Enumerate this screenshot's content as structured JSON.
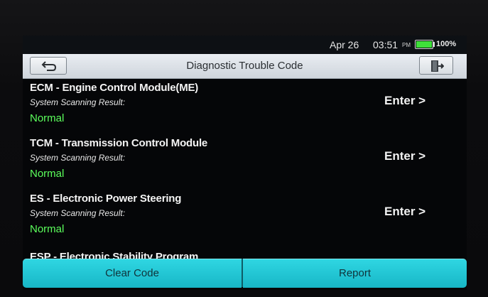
{
  "status_bar": {
    "date": "Apr 26",
    "time": "03:51",
    "ampm": "PM",
    "battery_percent": "100%",
    "battery_level": 1.0,
    "battery_color": "#3fe03a"
  },
  "header": {
    "title": "Diagnostic Trouble Code",
    "back_icon": "back-arrow-icon",
    "exit_icon": "exit-door-icon"
  },
  "modules": [
    {
      "name": "ECM - Engine Control Module(ME)",
      "caption": "System Scanning Result:",
      "status": "Normal",
      "enter_label": "Enter >"
    },
    {
      "name": "TCM - Transmission Control Module",
      "caption": "System Scanning Result:",
      "status": "Normal",
      "enter_label": "Enter >"
    },
    {
      "name": "ES - Electronic Power Steering",
      "caption": "System Scanning Result:",
      "status": "Normal",
      "enter_label": "Enter >"
    },
    {
      "name": "ESP - Electronic Stability Program"
    }
  ],
  "actions": {
    "clear_code": "Clear Code",
    "report": "Report"
  },
  "colors": {
    "accent": "#1fc3d2",
    "status_normal": "#5cff5c"
  }
}
